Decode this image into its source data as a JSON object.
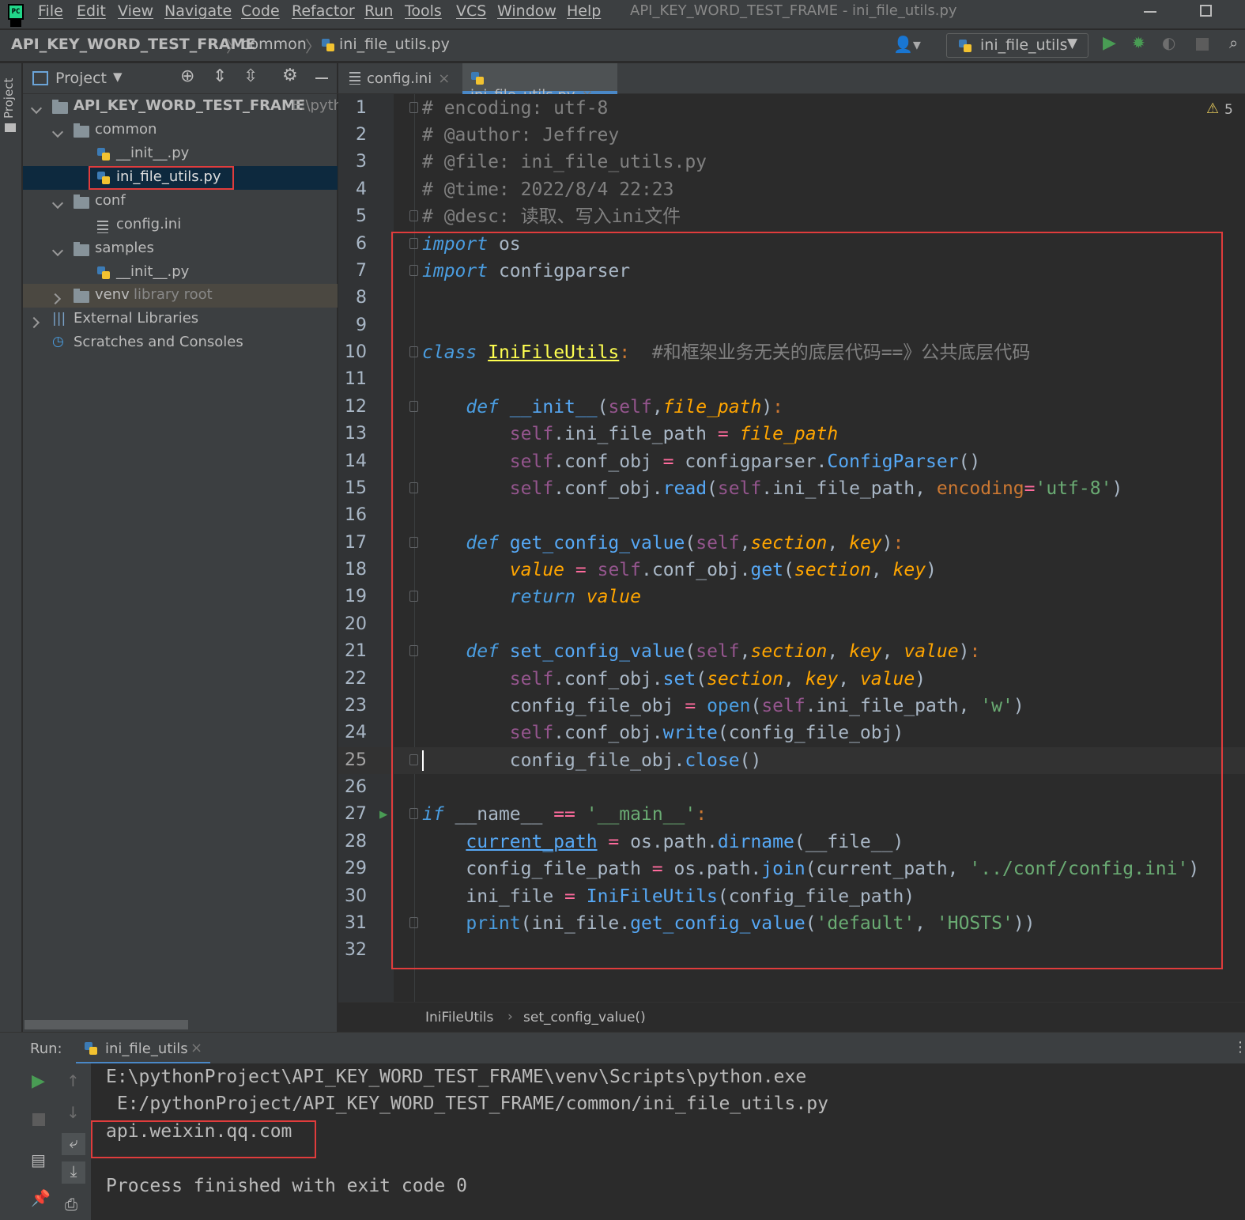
{
  "menu": [
    "File",
    "Edit",
    "View",
    "Navigate",
    "Code",
    "Refactor",
    "Run",
    "Tools",
    "VCS",
    "Window",
    "Help"
  ],
  "window_title": "API_KEY_WORD_TEST_FRAME - ini_file_utils.py",
  "breadcrumbs": [
    "API_KEY_WORD_TEST_FRAME",
    "common",
    "ini_file_utils.py"
  ],
  "run_config": "ini_file_utils",
  "side_tab": "Project",
  "project": {
    "header": "Project",
    "root": {
      "name": "API_KEY_WORD_TEST_FRAME",
      "path": "E:\\pyth"
    },
    "items": [
      {
        "label": "common"
      },
      {
        "label": "__init__.py"
      },
      {
        "label": "ini_file_utils.py"
      },
      {
        "label": "conf"
      },
      {
        "label": "config.ini"
      },
      {
        "label": "samples"
      },
      {
        "label": "__init__.py"
      },
      {
        "label": "venv",
        "note": "library root"
      },
      {
        "label": "External Libraries"
      },
      {
        "label": "Scratches and Consoles"
      }
    ]
  },
  "tabs": [
    "config.ini",
    "ini_file_utils.py"
  ],
  "warnings": "5",
  "code_lines": [
    "# encoding: utf-8",
    "# @author: Jeffrey",
    "# @file: ini_file_utils.py",
    "# @time: 2022/8/4 22:23",
    "# @desc: 读取、写入ini文件",
    "import os",
    "import configparser",
    "",
    "",
    "class IniFileUtils:  #和框架业务无关的底层代码==》公共底层代码",
    "",
    "    def __init__(self,file_path):",
    "        self.ini_file_path = file_path",
    "        self.conf_obj = configparser.ConfigParser()",
    "        self.conf_obj.read(self.ini_file_path, encoding='utf-8')",
    "",
    "    def get_config_value(self,section, key):",
    "        value = self.conf_obj.get(section, key)",
    "        return value",
    "",
    "    def set_config_value(self,section, key, value):",
    "        self.conf_obj.set(section, key, value)",
    "        config_file_obj = open(self.ini_file_path, 'w')",
    "        self.conf_obj.write(config_file_obj)",
    "        config_file_obj.close()",
    "",
    "if __name__ == '__main__':",
    "    current_path = os.path.dirname(__file__)",
    "    config_file_path = os.path.join(current_path, '../conf/config.ini')",
    "    ini_file = IniFileUtils(config_file_path)",
    "    print(ini_file.get_config_value('default', 'HOSTS'))",
    ""
  ],
  "editor_breadcrumb": [
    "IniFileUtils",
    "set_config_value()"
  ],
  "run": {
    "label": "Run:",
    "tab": "ini_file_utils",
    "output": [
      "E:\\pythonProject\\API_KEY_WORD_TEST_FRAME\\venv\\Scripts\\python.exe",
      " E:/pythonProject/API_KEY_WORD_TEST_FRAME/common/ini_file_utils.py",
      "api.weixin.qq.com",
      "",
      "Process finished with exit code 0"
    ]
  }
}
